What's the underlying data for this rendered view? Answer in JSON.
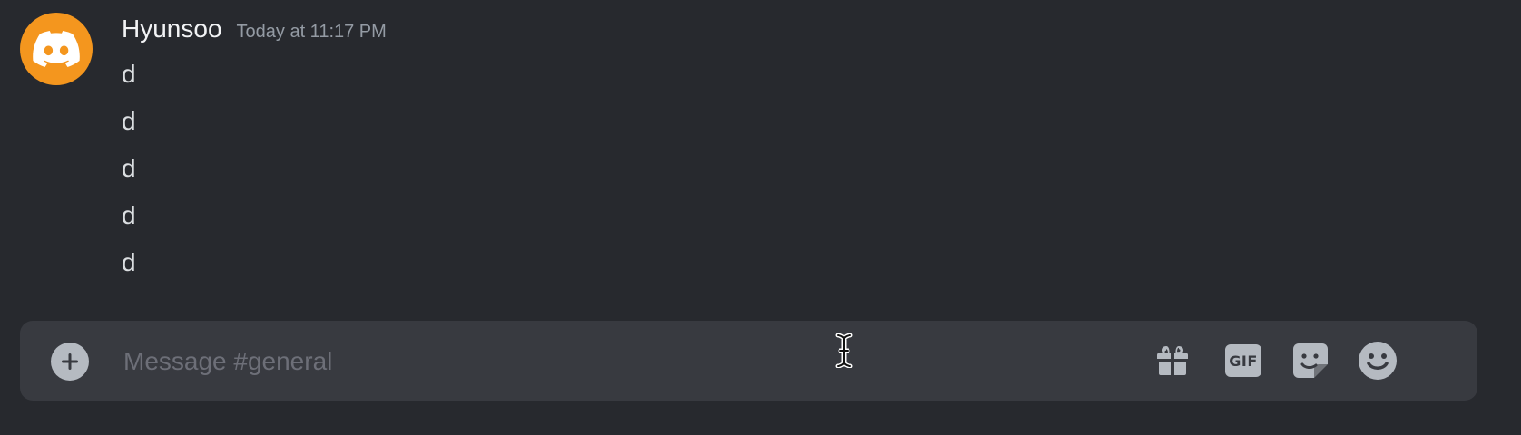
{
  "message": {
    "author": "Hyunsoo",
    "timestamp": "Today at 11:17 PM",
    "lines": [
      "d",
      "d",
      "d",
      "d",
      "d"
    ]
  },
  "composer": {
    "placeholder": "Message #general",
    "value": ""
  },
  "icons": {
    "avatar": "discord-logo-icon",
    "attach": "plus-circle-icon",
    "gift": "gift-icon",
    "gif": "gif-icon",
    "gif_label": "GIF",
    "sticker": "sticker-icon",
    "emoji": "emoji-icon",
    "mouse_cursor": "text-cursor-icon"
  },
  "colors": {
    "background": "#27292e",
    "composer": "#383a40",
    "avatar": "#f4961e",
    "icon": "#b5bac1"
  }
}
